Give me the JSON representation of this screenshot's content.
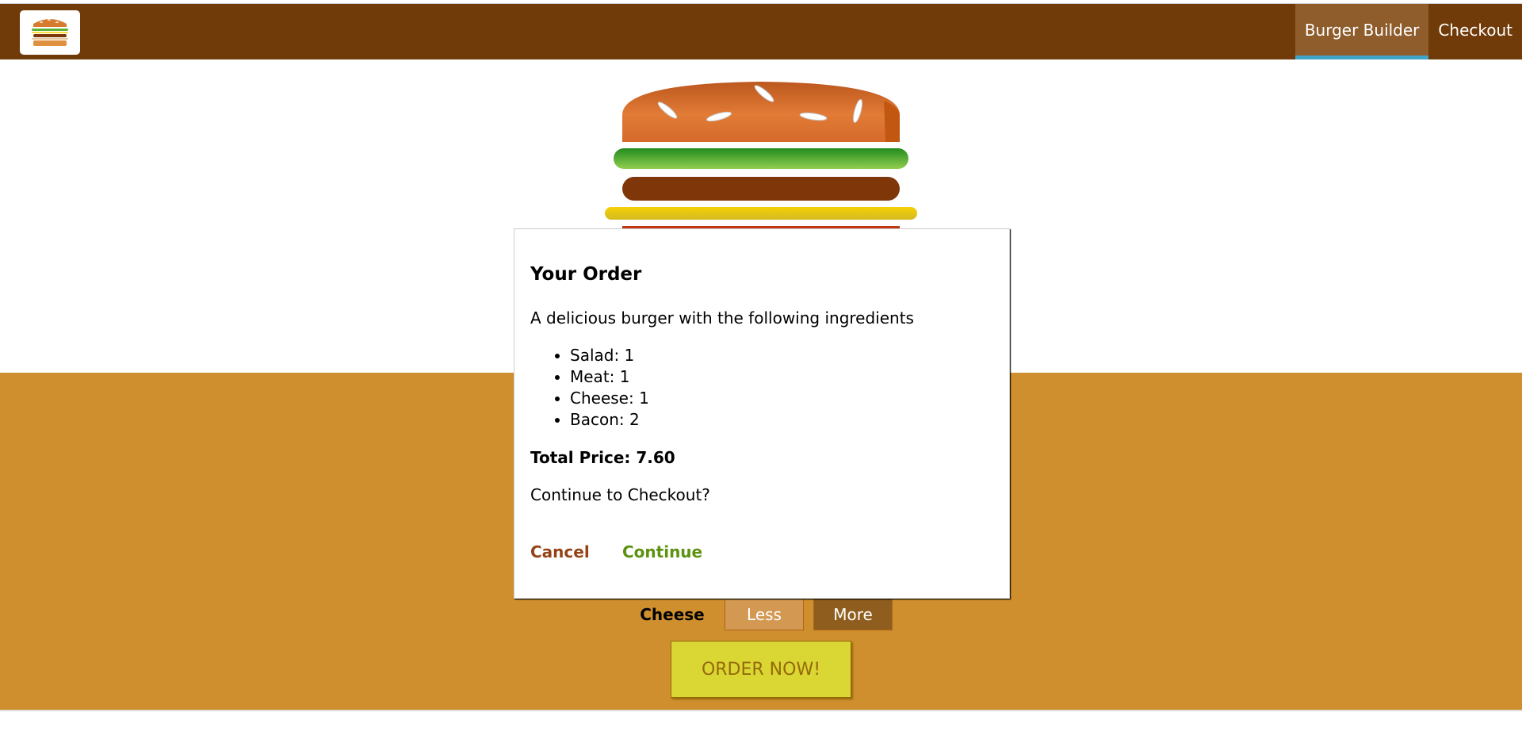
{
  "toolbar": {
    "logo_icon": "burger-logo-icon",
    "nav": [
      {
        "label": "Burger Builder",
        "active": true
      },
      {
        "label": "Checkout",
        "active": false
      }
    ]
  },
  "controls": {
    "cheese_label": "Cheese",
    "less_label": "Less",
    "more_label": "More",
    "order_button": "ORDER NOW!"
  },
  "modal": {
    "title": "Your Order",
    "description": "A delicious burger with the following ingredients",
    "ingredients": [
      "Salad: 1",
      "Meat: 1",
      "Cheese: 1",
      "Bacon: 2"
    ],
    "total": "Total Price: 7.60",
    "question": "Continue to Checkout?",
    "cancel": "Cancel",
    "continue": "Continue"
  },
  "colors": {
    "toolbar": "#703b09",
    "controls_bg": "#cf8f2e",
    "order_button": "#dad735",
    "cancel": "#944317",
    "continue": "#5c9210"
  }
}
